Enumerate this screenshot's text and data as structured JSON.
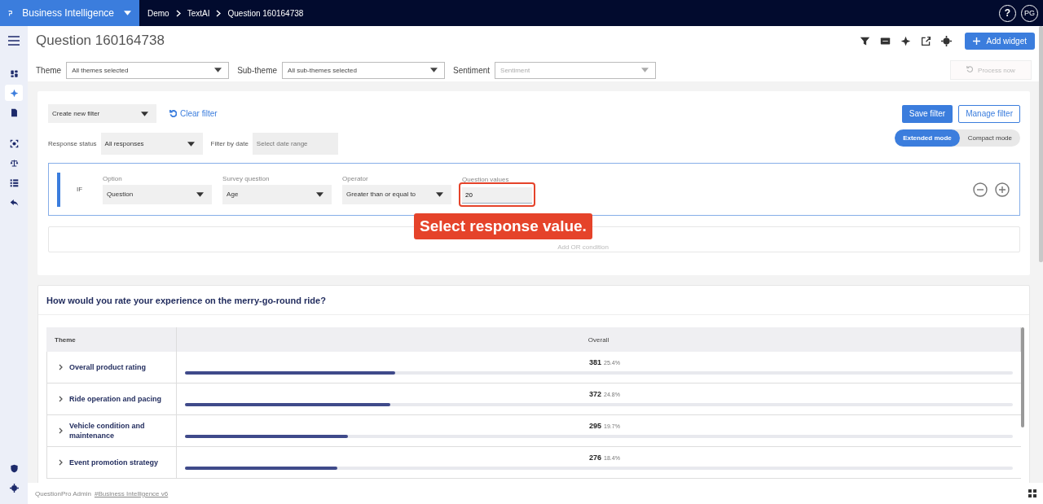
{
  "header": {
    "app_name": "Business Intelligence",
    "breadcrumbs": [
      "Demo",
      "TextAI",
      "Question 160164738"
    ],
    "help": "?",
    "avatar": "PG"
  },
  "sidebar": {
    "items": [
      {
        "kind": "dashboard",
        "selected": false
      },
      {
        "kind": "sparkle",
        "selected": true
      },
      {
        "kind": "document",
        "selected": false
      },
      {
        "kind": "scan",
        "selected": false
      },
      {
        "kind": "scales",
        "selected": false
      },
      {
        "kind": "list",
        "selected": false
      },
      {
        "kind": "reply",
        "selected": false
      }
    ],
    "bottom_items": [
      {
        "kind": "shield",
        "selected": false
      },
      {
        "kind": "gear",
        "selected": false
      }
    ]
  },
  "page": {
    "title": "Question 160164738",
    "add_widget": "Add widget",
    "filters": [
      {
        "label": "Theme",
        "value": "All themes selected"
      },
      {
        "label": "Sub-theme",
        "value": "All sub-themes selected"
      },
      {
        "label": "Sentiment",
        "placeholder": "Sentiment"
      }
    ],
    "process_now": {
      "label": "Process now",
      "disabled": true
    }
  },
  "filter_panel": {
    "create_filter": "Create new filter",
    "clear_filter": "Clear filter",
    "save_filter": "Save filter",
    "manage_filter": "Manage filter",
    "modes": [
      {
        "label": "Extended mode",
        "selected": true
      },
      {
        "label": "Compact mode",
        "selected": false
      }
    ],
    "response_status": {
      "label": "Response status",
      "value": "All responses"
    },
    "date": {
      "label": "Filter by date",
      "placeholder": "Select date range"
    },
    "condition": {
      "connector": "IF",
      "fields": [
        {
          "label": "Option",
          "value": "Question"
        },
        {
          "label": "Survey question",
          "value": "Age"
        },
        {
          "label": "Operator",
          "value": "Greater than or equal to"
        }
      ],
      "values_field": {
        "label": "Question values",
        "value": "20"
      }
    },
    "add_condition": "Add OR condition"
  },
  "callout": "Select response value.",
  "widget": {
    "title": "How would you rate your experience on the merry-go-round ride?",
    "table": {
      "columns": [
        "Theme",
        "Overall"
      ],
      "rows": [
        {
          "theme": "Overall product rating",
          "count": "381",
          "percent": "25.4%",
          "level": 0.254
        },
        {
          "theme": "Ride operation and pacing",
          "count": "372",
          "percent": "24.8%",
          "level": 0.248
        },
        {
          "theme": "Vehicle condition and maintenance",
          "count": "295",
          "percent": "19.7%",
          "level": 0.197
        },
        {
          "theme": "Event promotion strategy",
          "count": "276",
          "percent": "18.4%",
          "level": 0.184
        }
      ]
    }
  },
  "footer": {
    "text": "QuestionPro Admin",
    "link": "#Business Intelligence v6"
  }
}
